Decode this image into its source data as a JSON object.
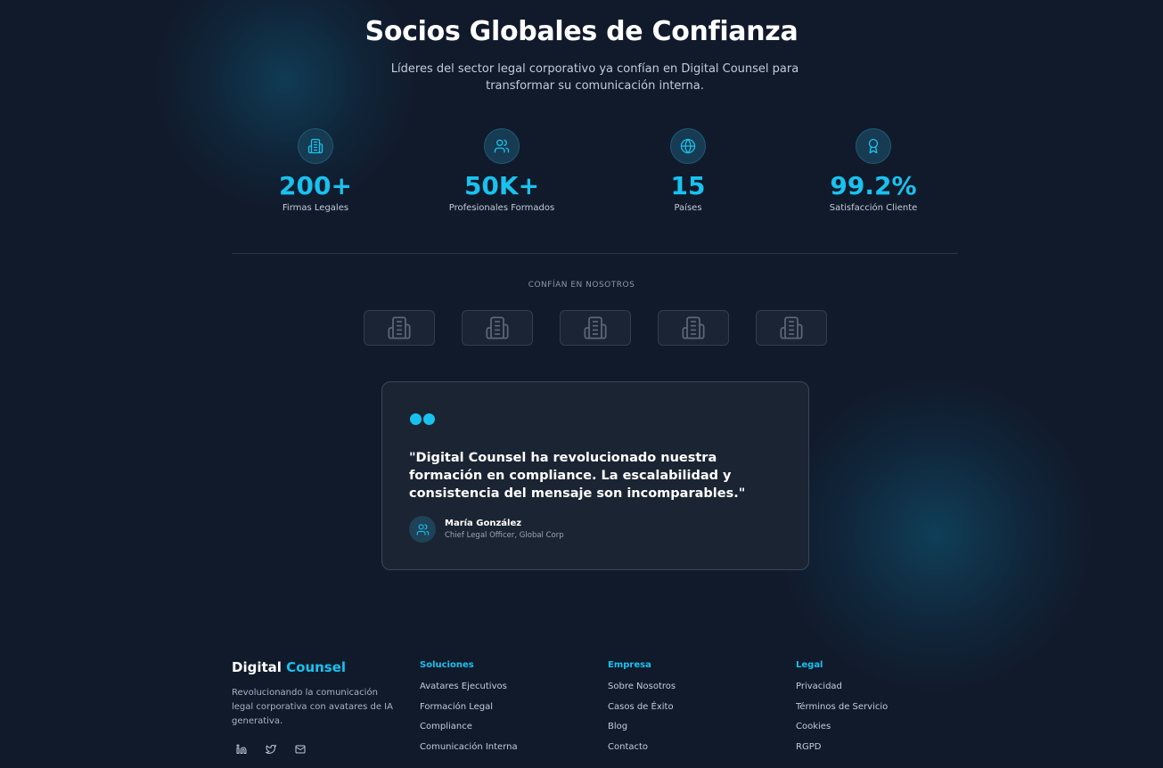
{
  "header": {
    "title": "Socios Globales de Confianza",
    "subtitle": "Líderes del sector legal corporativo ya confían en Digital Counsel para transformar su comunicación interna."
  },
  "stats": [
    {
      "icon": "building-icon",
      "value": "200+",
      "label": "Firmas Legales"
    },
    {
      "icon": "users-icon",
      "value": "50K+",
      "label": "Profesionales Formados"
    },
    {
      "icon": "globe-icon",
      "value": "15",
      "label": "Países"
    },
    {
      "icon": "award-icon",
      "value": "99.2%",
      "label": "Satisfacción Cliente"
    }
  ],
  "trust": {
    "label": "CONFÍAN EN NOSOTROS",
    "logos": [
      "building-icon",
      "building-icon",
      "building-icon",
      "building-icon",
      "building-icon"
    ]
  },
  "testimonial": {
    "quote": "\"Digital Counsel ha revolucionado nuestra formación en compliance. La escalabilidad y consistencia del mensaje son incomparables.\"",
    "author": "María González",
    "role": "Chief Legal Officer, Global Corp"
  },
  "footer": {
    "brand_main": "Digital",
    "brand_accent": "Counsel",
    "description": "Revolucionando la comunicación legal corporativa con avatares de IA generativa.",
    "socials": [
      "linkedin-icon",
      "twitter-icon",
      "mail-icon"
    ],
    "columns": [
      {
        "title": "Soluciones",
        "links": [
          "Avatares Ejecutivos",
          "Formación Legal",
          "Compliance",
          "Comunicación Interna"
        ]
      },
      {
        "title": "Empresa",
        "links": [
          "Sobre Nosotros",
          "Casos de Éxito",
          "Blog",
          "Contacto"
        ]
      },
      {
        "title": "Legal",
        "links": [
          "Privacidad",
          "Términos de Servicio",
          "Cookies",
          "RGPD"
        ]
      }
    ]
  },
  "colors": {
    "background": "#111a2b",
    "accent": "#19c2ee",
    "card": "#1b2432"
  }
}
